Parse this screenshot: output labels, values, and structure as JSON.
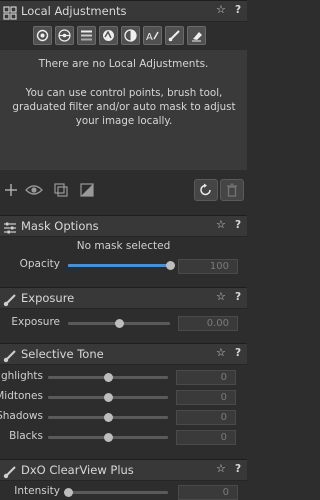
{
  "panels": {
    "local_adjustments": {
      "title": "Local Adjustments",
      "star": "☆",
      "help": "?"
    },
    "mask_options": {
      "title": "Mask Options",
      "star": "☆",
      "help": "?"
    },
    "exposure": {
      "title": "Exposure",
      "star": "☆",
      "help": "?"
    },
    "selective_tone": {
      "title": "Selective Tone",
      "star": "☆",
      "help": "?"
    },
    "clearview": {
      "title": "DxO ClearView Plus",
      "star": "☆",
      "help": "?"
    }
  },
  "empty_state": {
    "title": "There are no Local Adjustments.",
    "description": "You can use control points, brush tool, graduated filter and/or auto mask to adjust your image locally."
  },
  "mask": {
    "status": "No mask selected",
    "opacity_label": "Opacity",
    "opacity_value": "100",
    "opacity_fraction": 1.0
  },
  "exposure": {
    "label": "Exposure",
    "value": "0.00",
    "fraction": 0.5
  },
  "selective_tone": {
    "rows": [
      {
        "label": "Highlights",
        "value": "0",
        "fraction": 0.5
      },
      {
        "label": "Midtones",
        "value": "0",
        "fraction": 0.5
      },
      {
        "label": "Shadows",
        "value": "0",
        "fraction": 0.5
      },
      {
        "label": "Blacks",
        "value": "0",
        "fraction": 0.5
      }
    ]
  },
  "clearview": {
    "label": "Intensity",
    "value": "0",
    "fraction": 0.0
  },
  "colors": {
    "accent": "#4a8fd4",
    "panel_bg": "#2d2d2d",
    "header_bg": "#383838"
  },
  "icons": {
    "toolbar": [
      "control-point-icon",
      "control-line-icon",
      "graduated-filter-icon",
      "auto-mask-icon",
      "eraser-mask-icon",
      "repair-icon",
      "brush-icon",
      "eraser-icon"
    ],
    "bottom": [
      "add-icon",
      "show-mask-icon",
      "duplicate-icon",
      "invert-icon",
      "reset-icon",
      "delete-icon"
    ]
  }
}
